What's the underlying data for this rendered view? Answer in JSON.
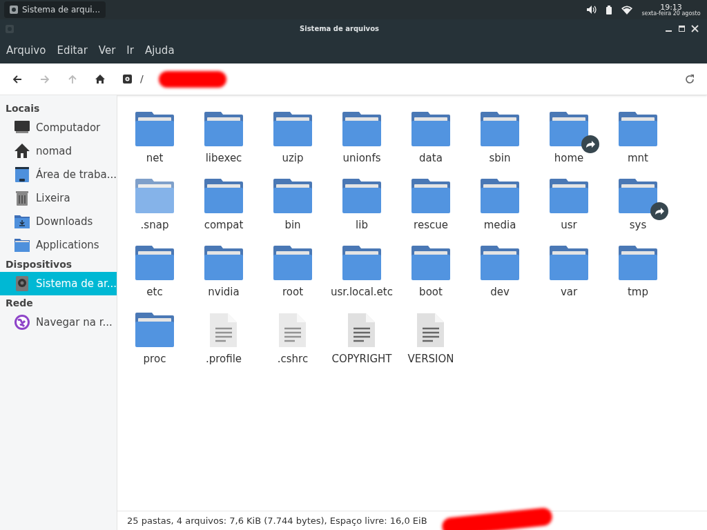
{
  "taskbar": {
    "window_button": "Sistema de arqui...",
    "time": "19:13",
    "date": "sexta-feira 20 agosto"
  },
  "window": {
    "title": "Sistema de arquivos"
  },
  "menu": [
    "Arquivo",
    "Editar",
    "Ver",
    "Ir",
    "Ajuda"
  ],
  "toolbar": {
    "path_separator": "/"
  },
  "sidebar": [
    {
      "heading": "Locais",
      "items": [
        {
          "kind": "computer",
          "label": "Computador",
          "selected": false
        },
        {
          "kind": "home",
          "label": "nomad",
          "selected": false
        },
        {
          "kind": "desktop",
          "label": "Área de traba...",
          "selected": false
        },
        {
          "kind": "trash",
          "label": "Lixeira",
          "selected": false
        },
        {
          "kind": "downloads",
          "label": "Downloads",
          "selected": false
        },
        {
          "kind": "folder",
          "label": "Applications",
          "selected": false
        }
      ]
    },
    {
      "heading": "Dispositivos",
      "items": [
        {
          "kind": "drive",
          "label": "Sistema de ar...",
          "selected": true
        }
      ]
    },
    {
      "heading": "Rede",
      "items": [
        {
          "kind": "network",
          "label": "Navegar na r...",
          "selected": false
        }
      ]
    }
  ],
  "files": [
    {
      "kind": "folder",
      "name": "net",
      "hidden": false,
      "symlink": false
    },
    {
      "kind": "folder",
      "name": "libexec",
      "hidden": false,
      "symlink": false
    },
    {
      "kind": "folder",
      "name": "uzip",
      "hidden": false,
      "symlink": false
    },
    {
      "kind": "folder",
      "name": "unionfs",
      "hidden": false,
      "symlink": false
    },
    {
      "kind": "folder",
      "name": "data",
      "hidden": false,
      "symlink": false
    },
    {
      "kind": "folder",
      "name": "sbin",
      "hidden": false,
      "symlink": false
    },
    {
      "kind": "folder",
      "name": "home",
      "hidden": false,
      "symlink": true
    },
    {
      "kind": "folder",
      "name": "mnt",
      "hidden": false,
      "symlink": false
    },
    {
      "kind": "folder",
      "name": ".snap",
      "hidden": true,
      "symlink": false
    },
    {
      "kind": "folder",
      "name": "compat",
      "hidden": false,
      "symlink": false
    },
    {
      "kind": "folder",
      "name": "bin",
      "hidden": false,
      "symlink": false
    },
    {
      "kind": "folder",
      "name": "lib",
      "hidden": false,
      "symlink": false
    },
    {
      "kind": "folder",
      "name": "rescue",
      "hidden": false,
      "symlink": false
    },
    {
      "kind": "folder",
      "name": "media",
      "hidden": false,
      "symlink": false
    },
    {
      "kind": "folder",
      "name": "usr",
      "hidden": false,
      "symlink": false
    },
    {
      "kind": "folder",
      "name": "sys",
      "hidden": false,
      "symlink": true
    },
    {
      "kind": "folder",
      "name": "etc",
      "hidden": false,
      "symlink": false
    },
    {
      "kind": "folder",
      "name": "nvidia",
      "hidden": false,
      "symlink": false
    },
    {
      "kind": "folder",
      "name": "root",
      "hidden": false,
      "symlink": false
    },
    {
      "kind": "folder",
      "name": "usr.local.etc",
      "hidden": false,
      "symlink": false
    },
    {
      "kind": "folder",
      "name": "boot",
      "hidden": false,
      "symlink": false
    },
    {
      "kind": "folder",
      "name": "dev",
      "hidden": false,
      "symlink": false
    },
    {
      "kind": "folder",
      "name": "var",
      "hidden": false,
      "symlink": false
    },
    {
      "kind": "folder",
      "name": "tmp",
      "hidden": false,
      "symlink": false
    },
    {
      "kind": "folder",
      "name": "proc",
      "hidden": false,
      "symlink": false
    },
    {
      "kind": "text-file",
      "name": ".profile",
      "hidden": true,
      "symlink": false
    },
    {
      "kind": "text-file",
      "name": ".cshrc",
      "hidden": true,
      "symlink": false
    },
    {
      "kind": "text-file",
      "name": "COPYRIGHT",
      "hidden": false,
      "symlink": false
    },
    {
      "kind": "text-file",
      "name": "VERSION",
      "hidden": false,
      "symlink": false
    }
  ],
  "status_bar": "25 pastas, 4 arquivos: 7,6 KiB (7.744 bytes), Espaço livre: 16,0 EiB"
}
